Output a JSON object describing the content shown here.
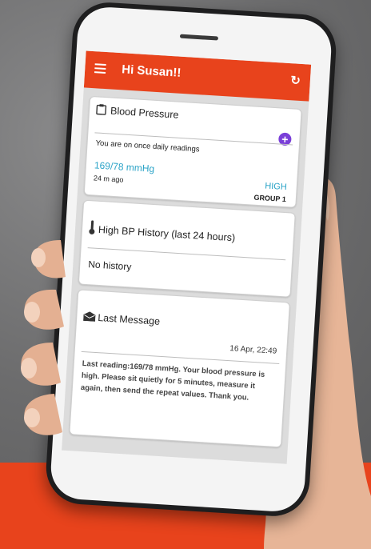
{
  "app": {
    "greeting": "Hi Susan!!",
    "menu_icon": "hamburger-menu-icon",
    "refresh_icon": "refresh-icon",
    "accent_color": "#e8431c",
    "link_color": "#2aa3c7",
    "add_color": "#7a3fd8"
  },
  "blood_pressure": {
    "title": "Blood Pressure",
    "icon": "clipboard-icon",
    "add_icon": "plus-circle-icon",
    "schedule": "You are on once daily readings",
    "reading": "169/78 mmHg",
    "time_ago": "24 m ago",
    "level": "HIGH",
    "group": "GROUP 1"
  },
  "history": {
    "title": "High BP History (last 24 hours)",
    "icon": "thermometer-icon",
    "empty_text": "No history"
  },
  "last_message": {
    "title": "Last Message",
    "icon": "envelope-icon",
    "date": "16 Apr, 22:49",
    "body": "Last reading:169/78 mmHg. Your blood pressure is high. Please sit quietly for 5 minutes, measure it again, then send the repeat values. Thank you."
  }
}
